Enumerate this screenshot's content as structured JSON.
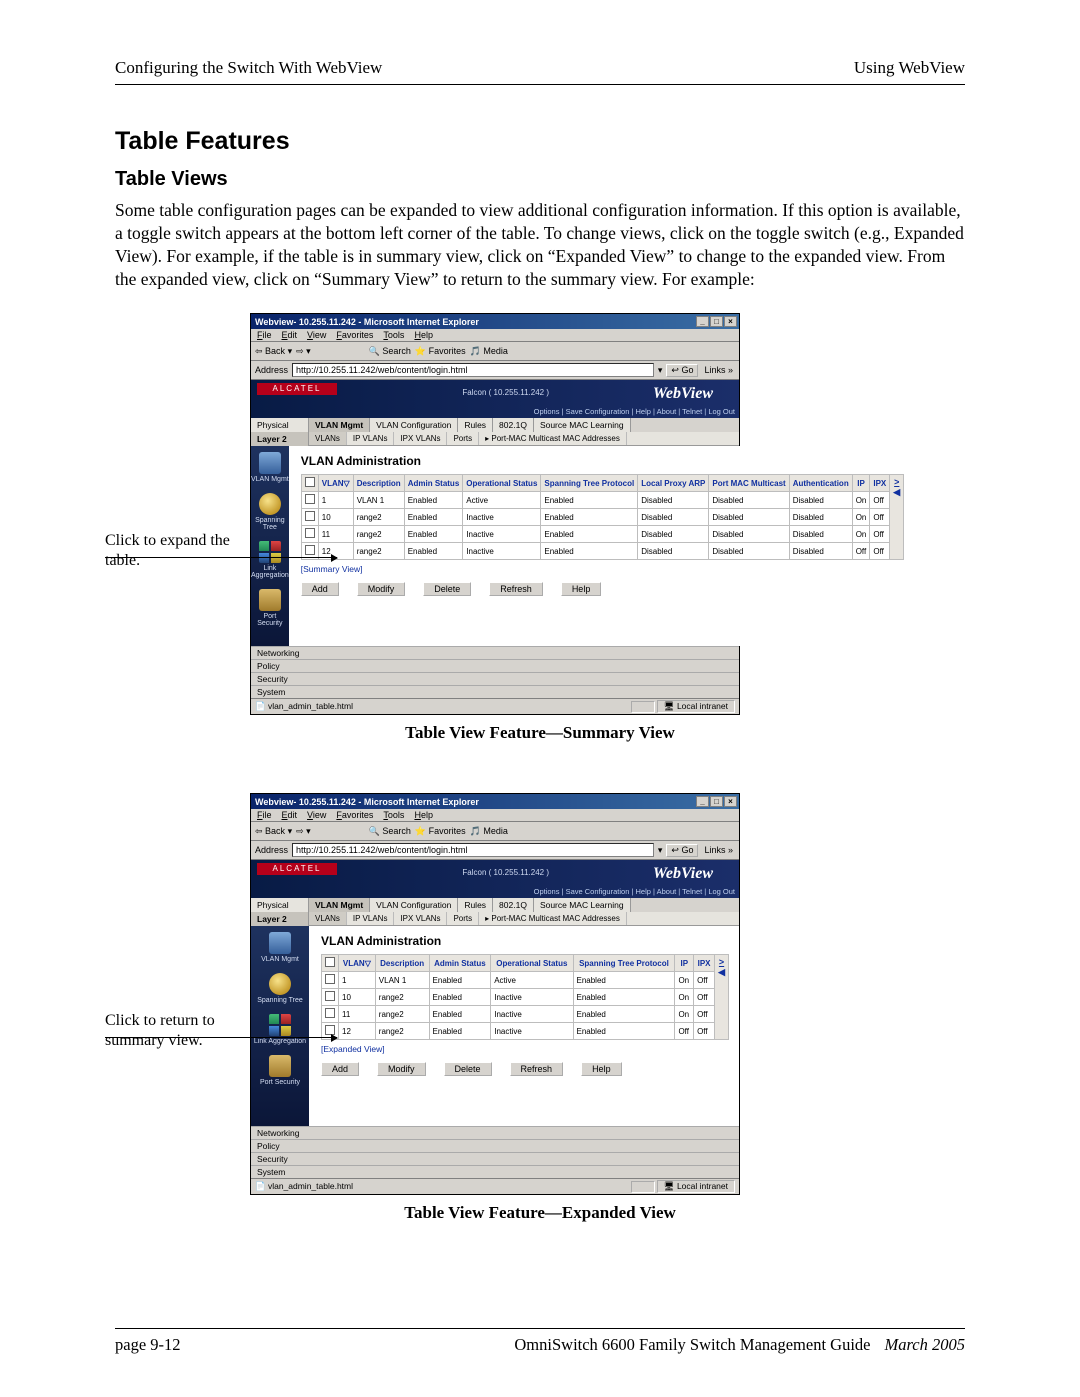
{
  "header": {
    "left": "Configuring the Switch With WebView",
    "right": "Using WebView"
  },
  "headings": {
    "table_features": "Table Features",
    "table_views": "Table Views"
  },
  "paragraph": "Some table configuration pages can be expanded to view additional configuration information. If this option is available, a toggle switch appears at the bottom left corner of the table. To change views, click on the toggle switch (e.g., Expanded View). For example, if the table is in summary view, click on “Expanded View” to change to the expanded view. From the expanded view, click on “Summary View” to return to the summary view. For example:",
  "captions": {
    "summary": "Table View Feature—Summary View",
    "expanded": "Table View Feature—Expanded View"
  },
  "callouts": {
    "expand": "Click to expand the table.",
    "return": "Click to return to summary view."
  },
  "browser": {
    "title": "Webview- 10.255.11.242 - Microsoft Internet Explorer",
    "menu": [
      "File",
      "Edit",
      "View",
      "Favorites",
      "Tools",
      "Help"
    ],
    "toolbar": {
      "back": "Back",
      "search": "Search",
      "favorites": "Favorites",
      "media": "Media"
    },
    "address_label": "Address",
    "address_url": "http://10.255.11.242/web/content/login.html",
    "go": "Go",
    "links": "Links",
    "status_file_summary": "vlan_admin_table.html",
    "status_file_expanded": "vlan_admin_table.html",
    "zone": "Local intranet"
  },
  "banner": {
    "logo": "ALCATEL",
    "webview": "WebView",
    "falcon": "Falcon  ( 10.255.11.242 )",
    "options": "Options | Save Configuration | Help | About | Telnet | Log Out"
  },
  "top_tabs_left": [
    "Physical",
    "Layer 2"
  ],
  "config_tabs": {
    "row1": [
      "VLAN Mgmt",
      "VLAN Configuration",
      "Rules",
      "802.1Q",
      "Source MAC Learning"
    ],
    "row2": [
      "VLANs",
      "IP VLANs",
      "IPX VLANs",
      "Ports",
      "Port-MAC Multicast MAC Addresses"
    ]
  },
  "sidebar": [
    "VLAN Mgmt",
    "Spanning Tree",
    "Link Aggregation",
    "Port Security"
  ],
  "bottom_nav": [
    "Networking",
    "Policy",
    "Security",
    "System"
  ],
  "panel_title": "VLAN Administration",
  "buttons": {
    "add": "Add",
    "modify": "Modify",
    "delete": "Delete",
    "refresh": "Refresh",
    "help": "Help"
  },
  "toggle": {
    "summary_link": "Summary View",
    "expanded_link": "Expanded View"
  },
  "summary_table": {
    "columns": [
      "VLAN▽",
      "Description",
      "Admin Status",
      "Operational Status",
      "Spanning Tree Protocol",
      "Local Proxy ARP",
      "Port MAC Multicast",
      "Authentication",
      "IP",
      "IPX"
    ],
    "rows": [
      {
        "vlan": "1",
        "desc": "VLAN 1",
        "admin": "Enabled",
        "oper": "Active",
        "stp": "Enabled",
        "arp": "Disabled",
        "mcast": "Disabled",
        "auth": "Disabled",
        "ip": "On",
        "ipx": "Off"
      },
      {
        "vlan": "10",
        "desc": "range2",
        "admin": "Enabled",
        "oper": "Inactive",
        "stp": "Enabled",
        "arp": "Disabled",
        "mcast": "Disabled",
        "auth": "Disabled",
        "ip": "On",
        "ipx": "Off"
      },
      {
        "vlan": "11",
        "desc": "range2",
        "admin": "Enabled",
        "oper": "Inactive",
        "stp": "Enabled",
        "arp": "Disabled",
        "mcast": "Disabled",
        "auth": "Disabled",
        "ip": "On",
        "ipx": "Off"
      },
      {
        "vlan": "12",
        "desc": "range2",
        "admin": "Enabled",
        "oper": "Inactive",
        "stp": "Enabled",
        "arp": "Disabled",
        "mcast": "Disabled",
        "auth": "Disabled",
        "ip": "Off",
        "ipx": "Off"
      }
    ]
  },
  "expanded_table": {
    "columns": [
      "VLAN▽",
      "Description",
      "Admin Status",
      "Operational Status",
      "Spanning Tree Protocol",
      "IP",
      "IPX"
    ],
    "rows": [
      {
        "vlan": "1",
        "desc": "VLAN 1",
        "admin": "Enabled",
        "oper": "Active",
        "stp": "Enabled",
        "ip": "On",
        "ipx": "Off"
      },
      {
        "vlan": "10",
        "desc": "range2",
        "admin": "Enabled",
        "oper": "Inactive",
        "stp": "Enabled",
        "ip": "On",
        "ipx": "Off"
      },
      {
        "vlan": "11",
        "desc": "range2",
        "admin": "Enabled",
        "oper": "Inactive",
        "stp": "Enabled",
        "ip": "On",
        "ipx": "Off"
      },
      {
        "vlan": "12",
        "desc": "range2",
        "admin": "Enabled",
        "oper": "Inactive",
        "stp": "Enabled",
        "ip": "Off",
        "ipx": "Off"
      }
    ]
  },
  "footer": {
    "page": "page 9-12",
    "guide": "OmniSwitch 6600 Family Switch Management Guide",
    "date": "March 2005"
  }
}
